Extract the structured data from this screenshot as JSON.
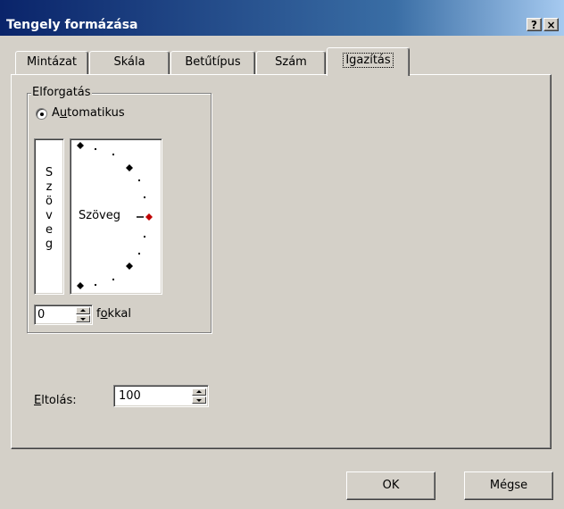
{
  "window": {
    "title": "Tengely formázása",
    "help_button": "?",
    "close_button": "×"
  },
  "tabs": [
    {
      "label": "Mintázat",
      "active": false
    },
    {
      "label": "Skála",
      "active": false
    },
    {
      "label": "Betűtípus",
      "active": false
    },
    {
      "label": "Szám",
      "active": false
    },
    {
      "label": "Igazítás",
      "active": true
    }
  ],
  "rotation": {
    "group_label": "Elforgatás",
    "automatic_radio": {
      "label_pre": "A",
      "label_accel": "u",
      "label_post": "tomatikus",
      "checked": true
    },
    "vertical_text": [
      "S",
      "z",
      "ö",
      "v",
      "e",
      "g"
    ],
    "dial_text": "Szöveg",
    "degrees_value": "0",
    "degrees_label_pre": "f",
    "degrees_label_accel": "o",
    "degrees_label_post": "kkal"
  },
  "offset": {
    "label_accel": "E",
    "label_post": "ltolás:",
    "value": "100"
  },
  "buttons": {
    "ok": "OK",
    "cancel": "Mégse"
  },
  "colors": {
    "title_bar": "#0a246a",
    "dialog_bg": "#d4d0c8",
    "dial_indicator": "#c00000"
  }
}
